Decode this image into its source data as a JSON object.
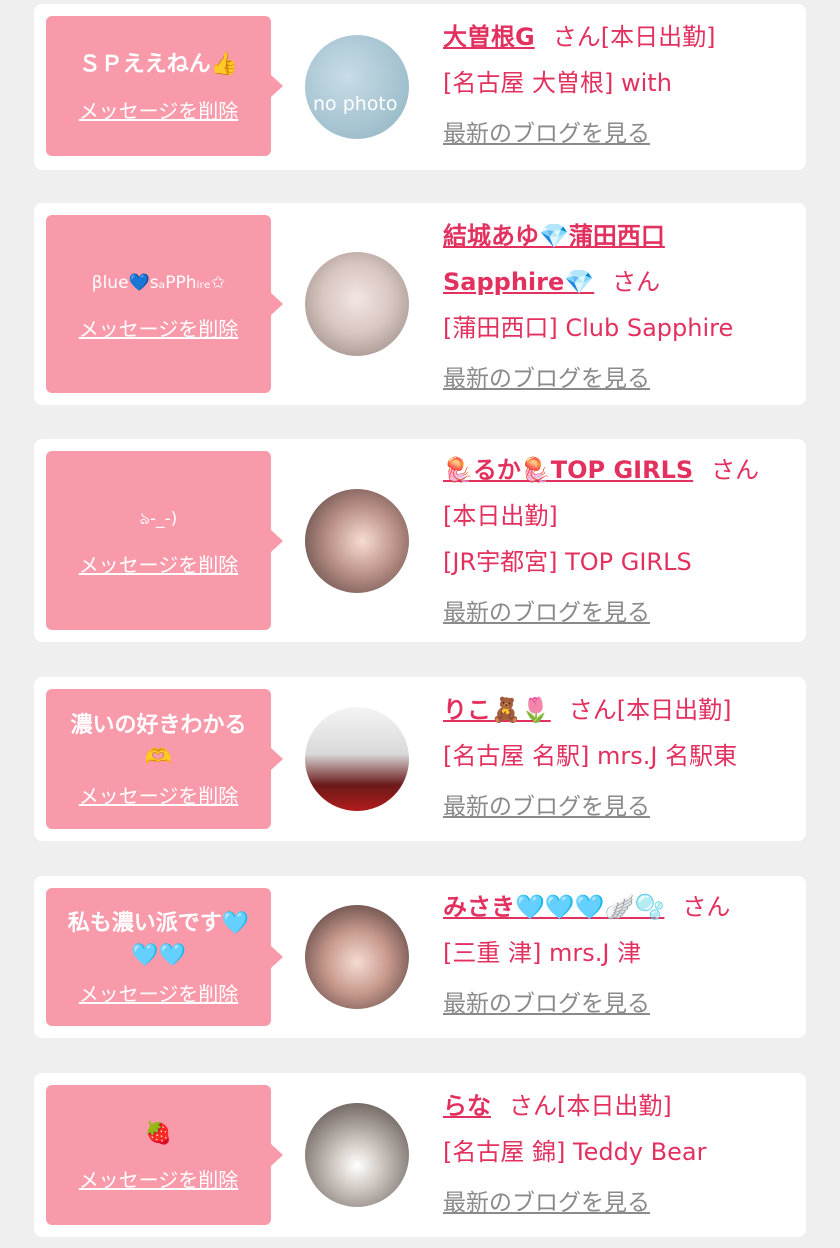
{
  "delete_label": "メッセージを削除",
  "blog_label": "最新のブログを見る",
  "san_label": "さん",
  "colors": {
    "bubble": "#f99aaa",
    "accent": "#e3315f",
    "link_gray": "#8a8a8a"
  },
  "cards": [
    {
      "message": "ＳＰええねん👍",
      "name": "大曽根G",
      "status": "[本日出勤]",
      "shop": "[名古屋 大曽根] with",
      "avatar_text": "no photo"
    },
    {
      "message": "βlue💙sₐPPhᵢᵣₑ✩",
      "name_line1": "結城あゆ💎蒲田西口",
      "name_line2": "Sapphire💎",
      "shop": "[蒲田西口] Club Sapphire"
    },
    {
      "message": "ঌ‐_-)",
      "name": "🪼るか🪼TOP GIRLS",
      "status": "[本日出勤]",
      "shop": "[JR宇都宮] TOP GIRLS"
    },
    {
      "message_line1": "濃いの好きわかる",
      "message_line2": "🫶",
      "name": "りこ🧸🌷",
      "status": "[本日出勤]",
      "shop": "[名古屋 名駅] mrs.J 名駅東"
    },
    {
      "message_line1": "私も濃い派です🩵",
      "message_line2": "🩵🩵",
      "name": "みさき🩵🩵🩵🪽🫧",
      "shop": "[三重 津] mrs.J 津"
    },
    {
      "message": "🍓",
      "name": "らな",
      "status": "[本日出勤]",
      "shop": "[名古屋 錦] Teddy Bear"
    }
  ]
}
